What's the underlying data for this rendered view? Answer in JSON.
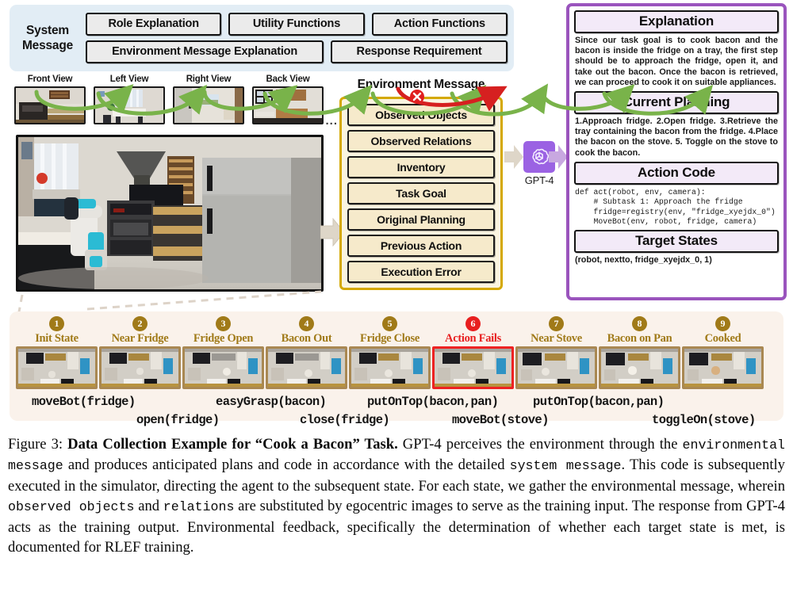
{
  "system_message": {
    "label": "System\nMessage",
    "label_line1": "System",
    "label_line2": "Message",
    "row1": [
      "Role Explanation",
      "Utility Functions",
      "Action Functions"
    ],
    "row2": [
      "Environment Message Explanation",
      "Response Requirement"
    ],
    "panel_color": "#e2edf5"
  },
  "views": [
    {
      "label": "Front View"
    },
    {
      "label": "Left View"
    },
    {
      "label": "Right View"
    },
    {
      "label": "Back View"
    }
  ],
  "views_ellipsis": "...",
  "environment_message": {
    "title": "Environment Message",
    "border_color": "#d4a800",
    "items": [
      "Observed Objects",
      "Observed Relations",
      "Inventory",
      "Task Goal",
      "Original Planning",
      "Previous Action",
      "Execution Error"
    ]
  },
  "model": {
    "label": "GPT-4",
    "icon": "openai-logo-icon",
    "icon_color": "#9b62e3"
  },
  "output_panel": {
    "border_color": "#9a54bd",
    "explanation_title": "Explanation",
    "explanation_body": "Since our task goal is to cook bacon and the bacon is inside the fridge on a tray, the first step should be to approach the fridge, open it, and take out the bacon. Once the bacon is retrieved, we can proceed to cook it on suitable appliances.",
    "planning_title": "Current Planning",
    "planning_body": "1.Approach fridge. 2.Open fridge. 3.Retrieve the tray containing the bacon from the fridge. 4.Place the bacon on the stove. 5. Toggle on the stove to cook the bacon.",
    "code_title": "Action Code",
    "code_body": "def act(robot, env, camera):\n    # Subtask 1: Approach the fridge\n    fridge=registry(env, \"fridge_xyejdx_0\")\n    MoveBot(env, robot, fridge, camera)",
    "target_title": "Target States",
    "target_body": "(robot, nextto, fridge_xyejdx_0, 1)"
  },
  "timeline": {
    "states": [
      {
        "num": "1",
        "label": "Init State",
        "failed": false
      },
      {
        "num": "2",
        "label": "Near Fridge",
        "failed": false
      },
      {
        "num": "3",
        "label": "Fridge Open",
        "failed": false
      },
      {
        "num": "4",
        "label": "Bacon Out",
        "failed": false
      },
      {
        "num": "5",
        "label": "Fridge Close",
        "failed": false
      },
      {
        "num": "6",
        "label": "Action Fails",
        "failed": true
      },
      {
        "num": "7",
        "label": "Near Stove",
        "failed": false
      },
      {
        "num": "8",
        "label": "Bacon on Pan",
        "failed": false
      },
      {
        "num": "9",
        "label": "Cooked",
        "failed": false
      }
    ],
    "actions": [
      {
        "text": "moveBot(fridge)",
        "row": 1
      },
      {
        "text": "open(fridge)",
        "row": 2
      },
      {
        "text": "easyGrasp(bacon)",
        "row": 1
      },
      {
        "text": "close(fridge)",
        "row": 2
      },
      {
        "text": "putOnTop(bacon,pan)",
        "row": 1,
        "failed": true
      },
      {
        "text": "moveBot(stove)",
        "row": 2
      },
      {
        "text": "putOnTop(bacon,pan)",
        "row": 1
      },
      {
        "text": "toggleOn(stove)",
        "row": 2
      }
    ],
    "badge_color": "#a07a18",
    "fail_color": "#e81f1f",
    "arrow_color": "#79b34a",
    "fail_arrow_color": "#d62020"
  },
  "caption": {
    "figure_number": "Figure 3:",
    "title": "Data Collection Example for “Cook a Bacon” Task.",
    "seg1": " GPT-4 perceives the environment through the ",
    "mono1": "environmental message",
    "seg2": " and produces anticipated plans and code in accordance with the detailed ",
    "mono2": "system message",
    "seg3": ". This code is subsequently executed in the simulator, directing the agent to the subsequent state. For each state, we gather the environmental message, wherein ",
    "mono3": "observed objects",
    "seg4": " and ",
    "mono4": "relations",
    "seg5": " are substituted by egocentric images to serve as the training input. The response from GPT-4 acts as the training output. Environmental feedback, specifically the determination of whether each target state is met, is documented for RLEF training."
  }
}
